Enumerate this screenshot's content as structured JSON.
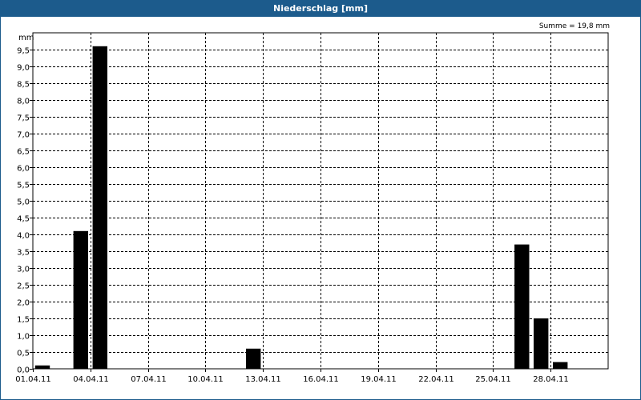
{
  "window": {
    "title": "Niederschlag [mm]"
  },
  "summary": "Summe = 19,8 mm",
  "chart_data": {
    "type": "bar",
    "title": "Niederschlag [mm]",
    "ylabel": "mm",
    "xlabel": "",
    "ylim": [
      0,
      10
    ],
    "xlim": [
      "2011-04-01",
      "2011-05-01"
    ],
    "grid": true,
    "ytick_labels": [
      "0,0",
      "0,5",
      "1,0",
      "1,5",
      "2,0",
      "2,5",
      "3,0",
      "3,5",
      "4,0",
      "4,5",
      "5,0",
      "5,5",
      "6,0",
      "6,5",
      "7,0",
      "7,5",
      "8,0",
      "8,5",
      "9,0",
      "9,5"
    ],
    "xtick_labels": [
      "01.04.11",
      "04.04.11",
      "07.04.11",
      "10.04.11",
      "13.04.11",
      "16.04.11",
      "19.04.11",
      "22.04.11",
      "25.04.11",
      "28.04.11"
    ],
    "x": [
      "2011-04-01",
      "2011-04-03",
      "2011-04-04",
      "2011-04-12",
      "2011-04-26",
      "2011-04-27",
      "2011-04-28"
    ],
    "values": [
      0.1,
      4.1,
      9.6,
      0.6,
      3.7,
      1.5,
      0.2
    ],
    "bar_color": "#000000",
    "grid_color": "#000000"
  }
}
